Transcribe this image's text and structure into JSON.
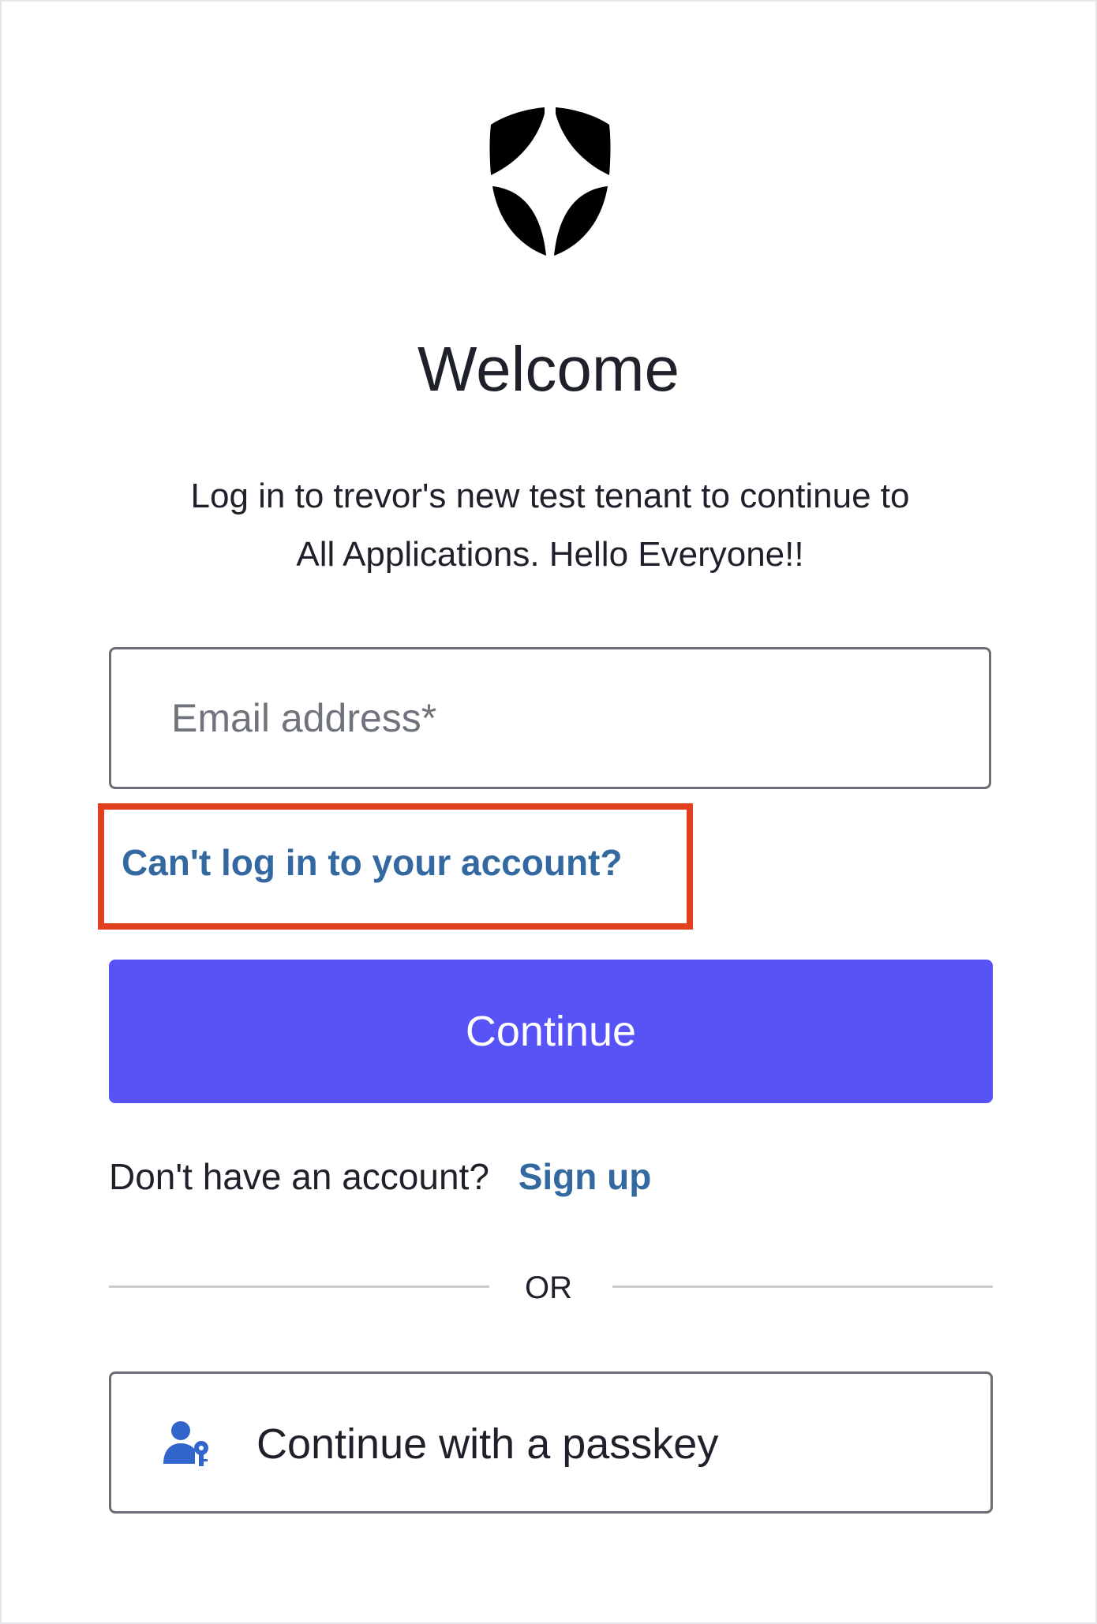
{
  "header": {
    "logo_icon": "shield-icon",
    "title": "Welcome",
    "subtitle_line1": "Log in to trevor's new test tenant to continue to",
    "subtitle_line2": "All Applications. Hello Everyone!!"
  },
  "form": {
    "email_placeholder": "Email address*",
    "forgot_link": "Can't log in to your account?",
    "continue_label": "Continue",
    "signup_prompt": "Don't have an account?",
    "signup_link": "Sign up",
    "divider_text": "OR",
    "passkey_label": "Continue with a passkey",
    "passkey_icon": "user-key-icon"
  },
  "colors": {
    "primary": "#5853f6",
    "link": "#3369a0",
    "highlight": "#e2401f",
    "text": "#1e212a"
  }
}
